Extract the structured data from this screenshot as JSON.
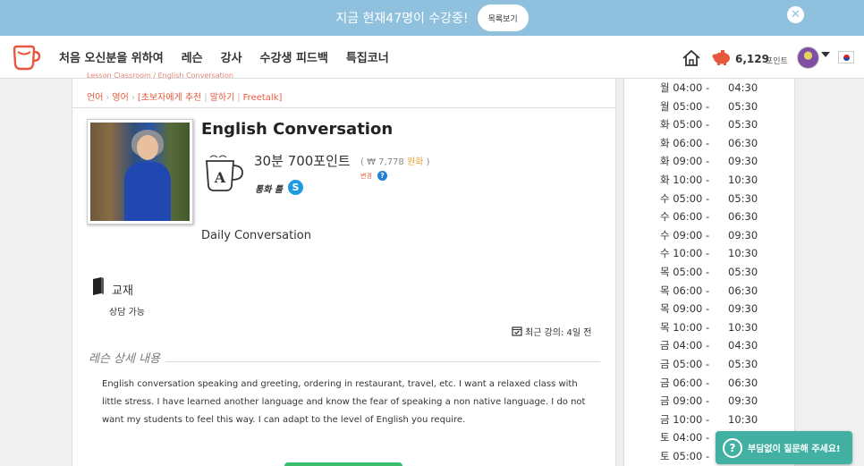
{
  "banner": {
    "text": "지금 현재47명이 수강중!",
    "button_label": "목록보기",
    "close_glyph": "✕"
  },
  "nav": {
    "menu": [
      "처음 오신분을 위하여",
      "레슨",
      "강사",
      "수강생 피드백",
      "특집코너"
    ],
    "points": "6,129",
    "points_unit": "포인트"
  },
  "lesson": {
    "breadcrumb_top": "Lesson Classroom / English Conversation",
    "breadcrumb": [
      "언어",
      "영어",
      "[초보자에게 추천",
      "말하기",
      "Freetalk]"
    ],
    "title": "English Conversation",
    "price": "30분 700포인트",
    "won_prefix": "( ₩ 7,778",
    "won_currency": "원화",
    "won_suffix": ")",
    "change": "변경",
    "help_glyph": "?",
    "tool": "통화 툴",
    "skype_glyph": "S",
    "subtitle": "Daily Conversation",
    "material_title": "교재",
    "material_value": "상담 가능",
    "recent": "최근 강의: 4일 전",
    "detail_title": "레슨 상세 내용",
    "description": "English conversation speaking and greeting, ordering in restaurant, travel, etc. I want a relaxed class with little stress. I have learned another language and know the fear of speaking a non native language. I do not want my students to feel this way. I can adapt to the level of English you require."
  },
  "schedule": [
    {
      "start": "월 04:00 -",
      "end": "04:30"
    },
    {
      "start": "월 05:00 -",
      "end": "05:30"
    },
    {
      "start": "화 05:00 -",
      "end": "05:30"
    },
    {
      "start": "화 06:00 -",
      "end": "06:30"
    },
    {
      "start": "화 09:00 -",
      "end": "09:30"
    },
    {
      "start": "화 10:00 -",
      "end": "10:30"
    },
    {
      "start": "수 05:00 -",
      "end": "05:30"
    },
    {
      "start": "수 06:00 -",
      "end": "06:30"
    },
    {
      "start": "수 09:00 -",
      "end": "09:30"
    },
    {
      "start": "수 10:00 -",
      "end": "10:30"
    },
    {
      "start": "목 05:00 -",
      "end": "05:30"
    },
    {
      "start": "목 06:00 -",
      "end": "06:30"
    },
    {
      "start": "목 09:00 -",
      "end": "09:30"
    },
    {
      "start": "목 10:00 -",
      "end": "10:30"
    },
    {
      "start": "금 04:00 -",
      "end": "04:30"
    },
    {
      "start": "금 05:00 -",
      "end": "05:30"
    },
    {
      "start": "금 06:00 -",
      "end": "06:30"
    },
    {
      "start": "금 09:00 -",
      "end": "09:30"
    },
    {
      "start": "금 10:00 -",
      "end": "10:30"
    },
    {
      "start": "토 04:00 -",
      "end": ""
    },
    {
      "start": "토 05:00 -",
      "end": ""
    }
  ],
  "help": {
    "glyph": "?",
    "text": "부담없이 질문해 주세요!"
  },
  "colors": {
    "banner": "#8fc1df",
    "accent": "#e8583e",
    "help_button": "#42b1a3",
    "skype": "#1e9be0"
  }
}
